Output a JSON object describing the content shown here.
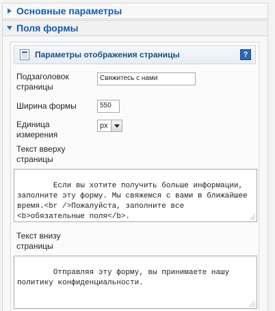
{
  "accordion": {
    "basic_params": {
      "title": "Основные параметры",
      "icon": "triangle-right-icon"
    },
    "form_fields": {
      "title": "Поля формы",
      "icon": "triangle-down-icon"
    }
  },
  "panel": {
    "header_title": "Параметры отображения страницы",
    "help_label": "?",
    "fields": {
      "subtitle": {
        "label": "Подзаголовок страницы",
        "value": "Свяжитесь с нами"
      },
      "form_width": {
        "label": "Ширина формы",
        "value": "550"
      },
      "unit": {
        "label": "Единица измерения",
        "selected": "px"
      },
      "top_text": {
        "label": "Текст вверху страницы",
        "value": "Если вы хотите получить больше информации, заполните эту форму. Мы свяжемся с вами в ближайшее время.<br />Пожалуйста, заполните все <b>обязательные поля</b>."
      },
      "bottom_text": {
        "label": "Текст внизу страницы",
        "value": "Отправляя эту форму, вы принимаете нашу политику конфиденциальности."
      }
    }
  },
  "colors": {
    "accent": "#135cae",
    "triangle": "#2b6fb6",
    "help_bg": "#2d66b8"
  }
}
